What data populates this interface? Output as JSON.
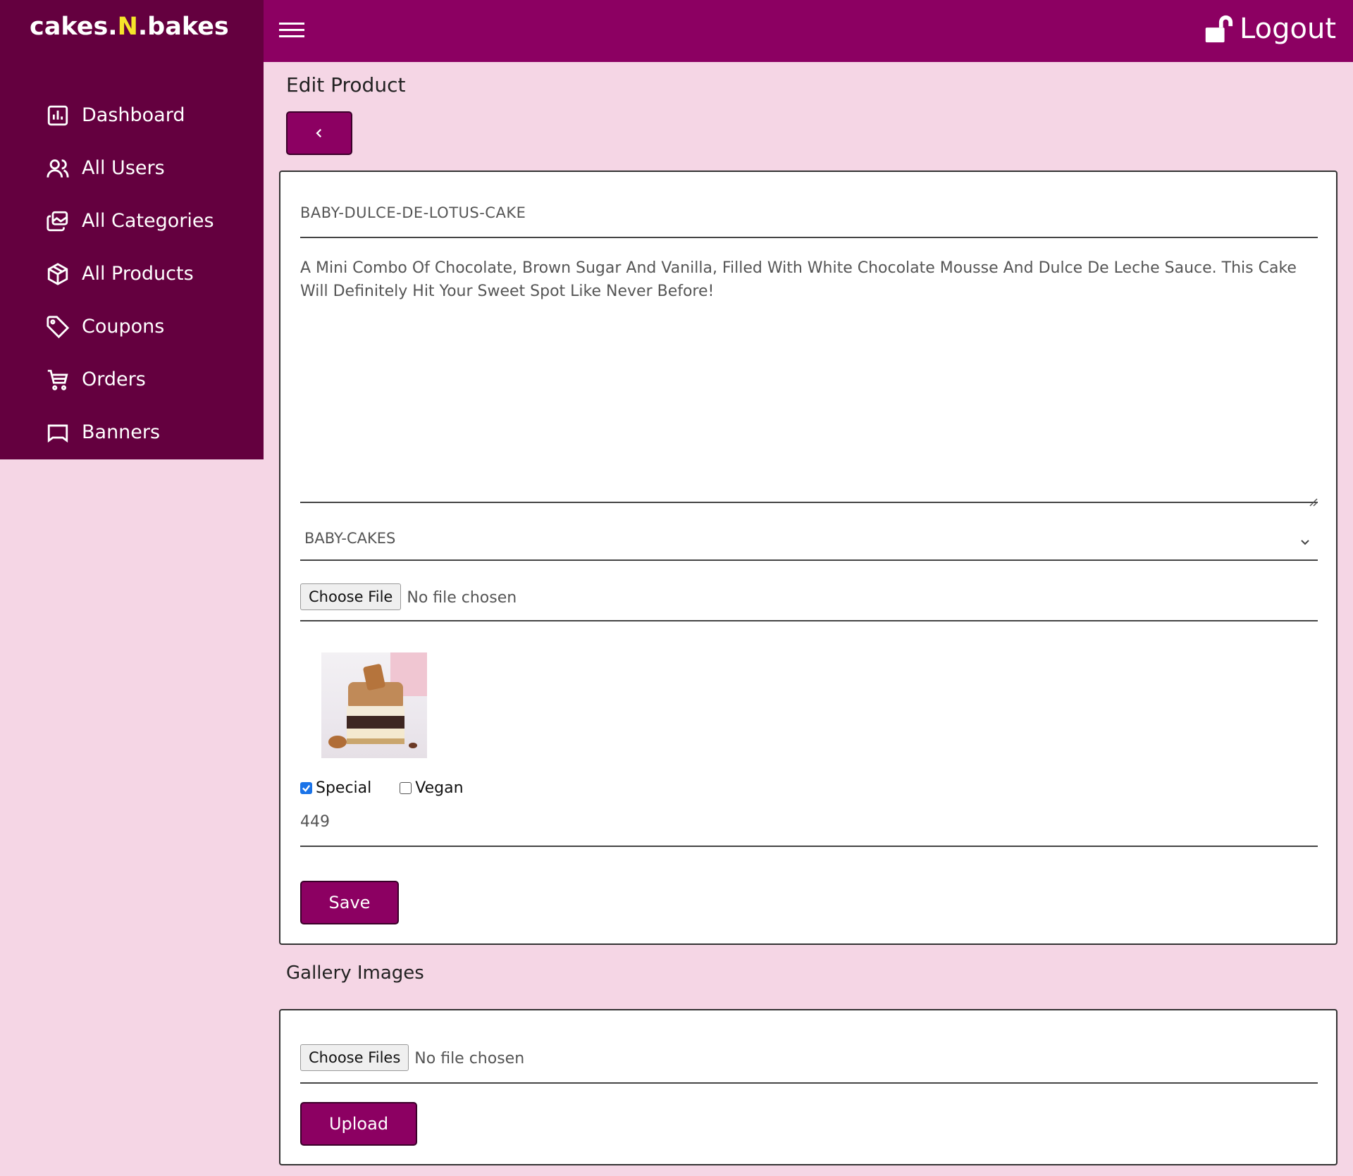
{
  "brand": {
    "part1": "cakes.",
    "part2": "N",
    "part3": ".bakes",
    "accent_color": "#f5e52a"
  },
  "colors": {
    "sidebar": "#64003f",
    "topbar": "#8c0062",
    "page_bg": "#f5d6e5",
    "primary": "#8c0062"
  },
  "sidebar": {
    "items": [
      {
        "label": "Dashboard",
        "icon": "bar-chart-icon"
      },
      {
        "label": "All Users",
        "icon": "users-icon"
      },
      {
        "label": "All Categories",
        "icon": "layers-icon"
      },
      {
        "label": "All Products",
        "icon": "box-icon"
      },
      {
        "label": "Coupons",
        "icon": "tag-icon"
      },
      {
        "label": "Orders",
        "icon": "cart-icon"
      },
      {
        "label": "Banners",
        "icon": "banner-icon"
      }
    ]
  },
  "header": {
    "menu_icon": "hamburger-icon",
    "logout_label": "Logout",
    "logout_icon": "unlock-icon"
  },
  "main": {
    "title": "Edit Product",
    "back_icon": "chevron-left-icon",
    "form": {
      "name": "BABY-DULCE-DE-LOTUS-CAKE",
      "description_line1": "A Mini Combo Of Chocolate, Brown Sugar And Vanilla, Filled With White Chocolate Mousse And Dulce De Leche Sauce. This Cake",
      "description_line2": "Will Definitely Hit Your Sweet Spot Like Never Before!",
      "category": "BABY-CAKES",
      "file_button": "Choose File",
      "file_status": "No file chosen",
      "special_label": "Special",
      "special_checked": true,
      "vegan_label": "Vegan",
      "vegan_checked": false,
      "price": "449",
      "save_label": "Save"
    },
    "gallery": {
      "title": "Gallery Images",
      "file_button": "Choose Files",
      "file_status": "No file chosen",
      "upload_label": "Upload"
    }
  }
}
